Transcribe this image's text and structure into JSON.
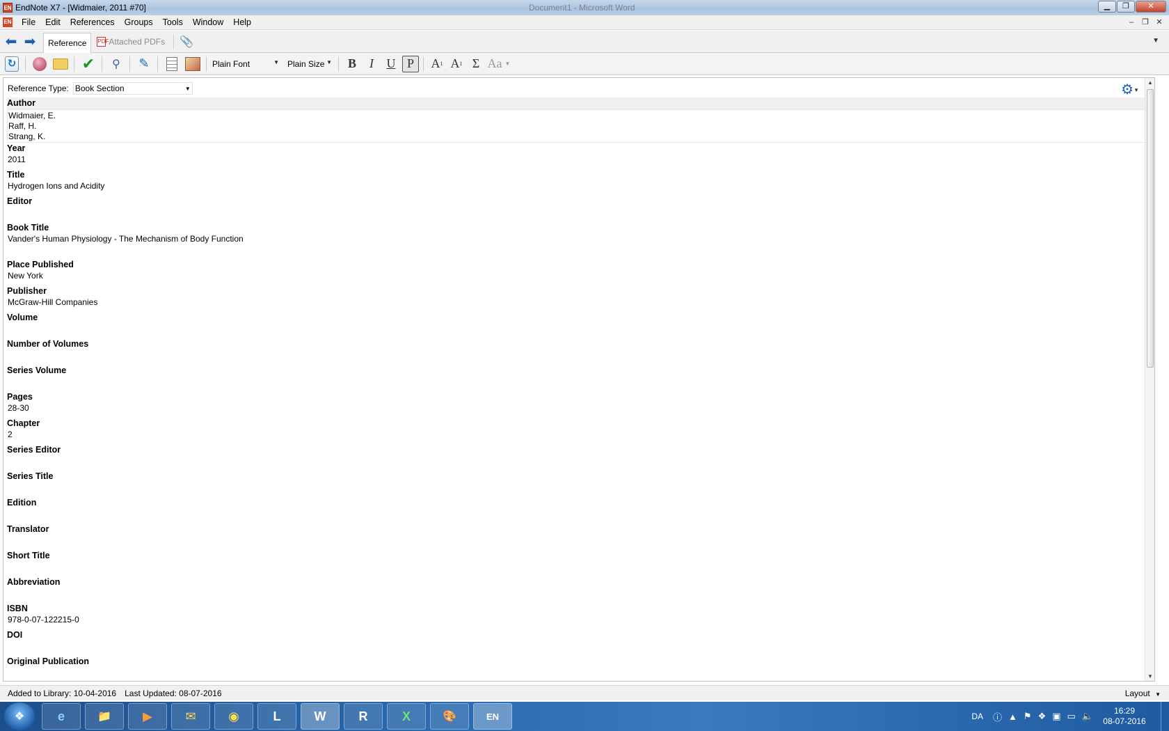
{
  "window": {
    "title": "EndNote X7 - [Widmaier, 2011 #70]",
    "background_title": "Document1 - Microsoft Word",
    "app_icon": "EN"
  },
  "menu": {
    "items": [
      "File",
      "Edit",
      "References",
      "Groups",
      "Tools",
      "Window",
      "Help"
    ]
  },
  "tabs": {
    "reference": "Reference",
    "attached_pdfs": "Attached PDFs"
  },
  "toolbar": {
    "font_select": "Plain Font",
    "size_select": "Plain Size",
    "bold": "B",
    "italic": "I",
    "underline": "U",
    "plain": "P",
    "superscript": "A",
    "subscript": "A",
    "symbol": "Σ",
    "case": "Aa"
  },
  "reference": {
    "type_label": "Reference Type:",
    "type_value": "Book Section",
    "fields": [
      {
        "label": "Author",
        "value": "Widmaier, E.\nRaff, H.\nStrang, K."
      },
      {
        "label": "Year",
        "value": "2011"
      },
      {
        "label": "Title",
        "value": "Hydrogen Ions and Acidity"
      },
      {
        "label": "Editor",
        "value": ""
      },
      {
        "label": "Book Title",
        "value": "Vander's Human Physiology - The Mechanism of Body Function"
      },
      {
        "label": "Place Published",
        "value": "New York"
      },
      {
        "label": "Publisher",
        "value": "McGraw-Hill Companies"
      },
      {
        "label": "Volume",
        "value": ""
      },
      {
        "label": "Number of Volumes",
        "value": ""
      },
      {
        "label": "Series Volume",
        "value": ""
      },
      {
        "label": "Pages",
        "value": "28-30"
      },
      {
        "label": "Chapter",
        "value": "2"
      },
      {
        "label": "Series Editor",
        "value": ""
      },
      {
        "label": "Series Title",
        "value": ""
      },
      {
        "label": "Edition",
        "value": ""
      },
      {
        "label": "Translator",
        "value": ""
      },
      {
        "label": "Short Title",
        "value": ""
      },
      {
        "label": "Abbreviation",
        "value": ""
      },
      {
        "label": "ISBN",
        "value": "978-0-07-122215-0"
      },
      {
        "label": "DOI",
        "value": ""
      },
      {
        "label": "Original Publication",
        "value": ""
      }
    ]
  },
  "status": {
    "added": "Added to Library: 10-04-2016",
    "updated": "Last Updated: 08-07-2016",
    "layout": "Layout"
  },
  "taskbar": {
    "apps": [
      "e",
      "📁",
      "▶",
      "✉",
      "◉",
      "L",
      "W",
      "R",
      "X",
      "🎨",
      "EN"
    ],
    "language": "DA",
    "time": "16:29",
    "date": "08-07-2016"
  }
}
